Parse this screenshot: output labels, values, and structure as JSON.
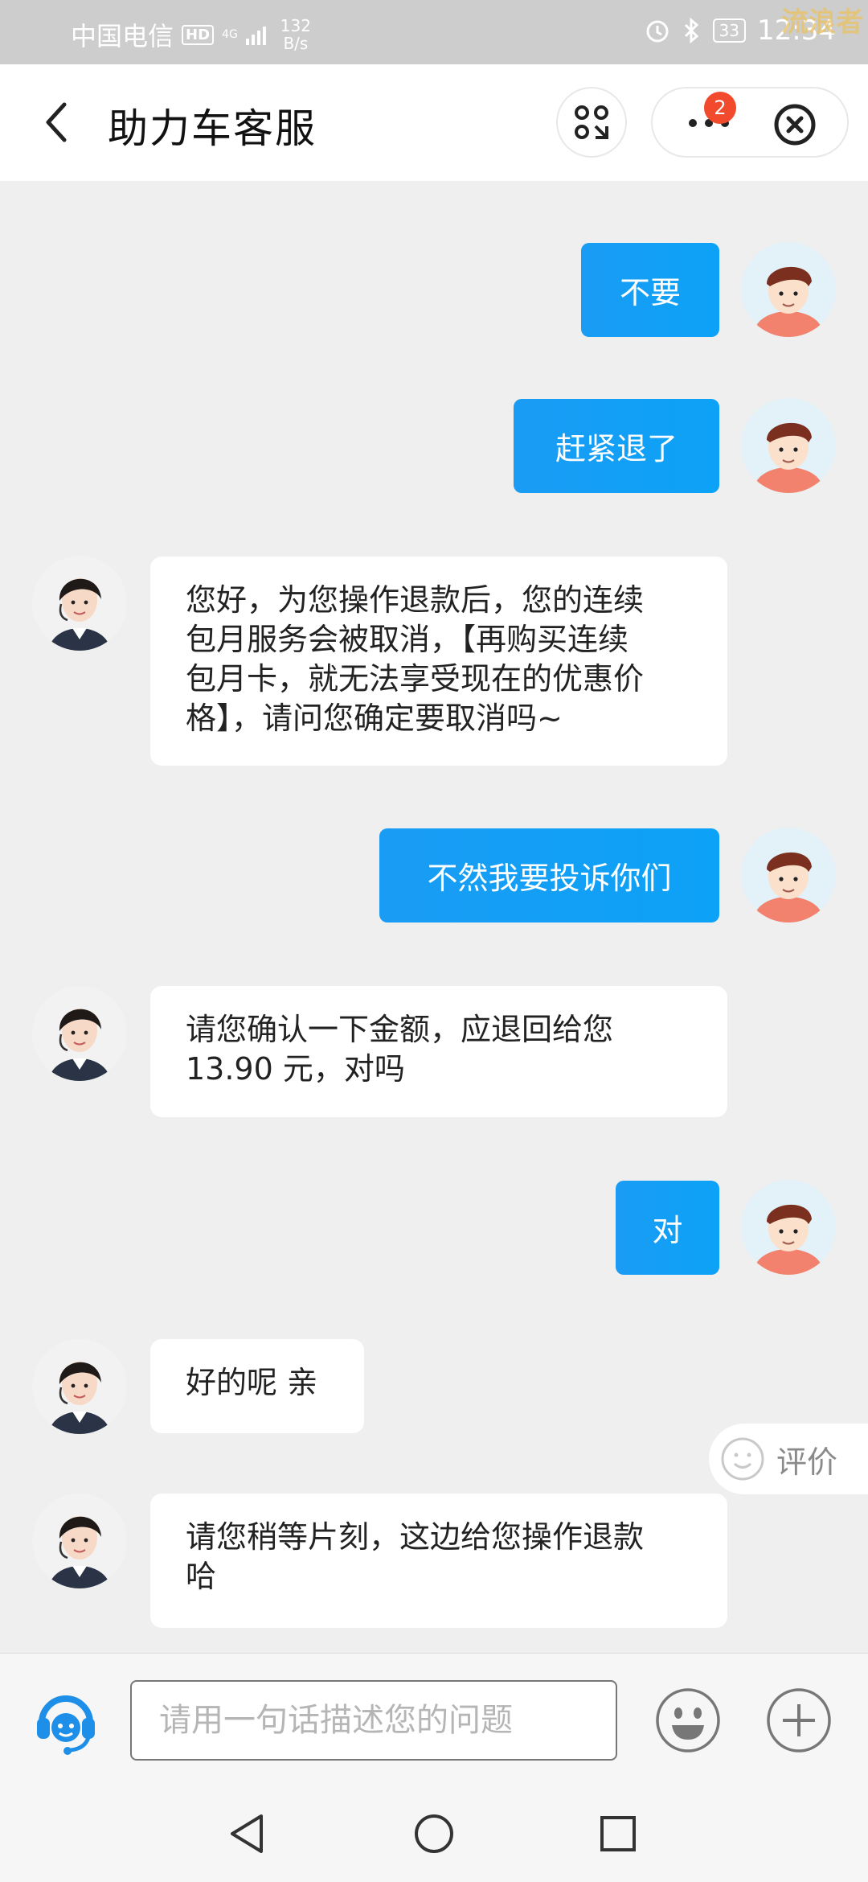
{
  "status_bar": {
    "carrier": "中国电信",
    "hd": "HD",
    "network": "4G",
    "speed_value": "132",
    "speed_unit": "B/s",
    "battery": "33",
    "time": "12:34",
    "watermark": "流浪者"
  },
  "header": {
    "title": "助力车客服",
    "more_badge": "2"
  },
  "messages": [
    {
      "side": "out",
      "text": "不要"
    },
    {
      "side": "out",
      "text": "赶紧退了"
    },
    {
      "side": "in",
      "lines": [
        "您好，为您操作退款后，您的连续",
        "包月服务会被取消，【再购买连续",
        "包月卡，就无法享受现在的优惠价",
        "格】，请问您确定要取消吗~"
      ]
    },
    {
      "side": "out",
      "text": "不然我要投诉你们"
    },
    {
      "side": "in",
      "lines": [
        "请您确认一下金额，应退回给您",
        "13.90 元，对吗"
      ]
    },
    {
      "side": "out",
      "text": "对"
    },
    {
      "side": "in",
      "lines": [
        "好的呢 亲"
      ]
    },
    {
      "side": "in",
      "lines": [
        "请您稍等片刻，这边给您操作退款",
        "哈"
      ]
    }
  ],
  "rate_button": {
    "label": "评价"
  },
  "input_bar": {
    "placeholder": "请用一句话描述您的问题"
  },
  "colors": {
    "accent": "#0ca2f7",
    "badge": "#f24a2c",
    "background": "#efefef"
  },
  "icons": {
    "back": "chevron-left-icon",
    "scan": "scan-icon",
    "more": "more-dots-icon",
    "close": "close-circle-icon",
    "service": "headset-icon",
    "emoji": "emoji-icon",
    "plus": "plus-circle-icon"
  }
}
